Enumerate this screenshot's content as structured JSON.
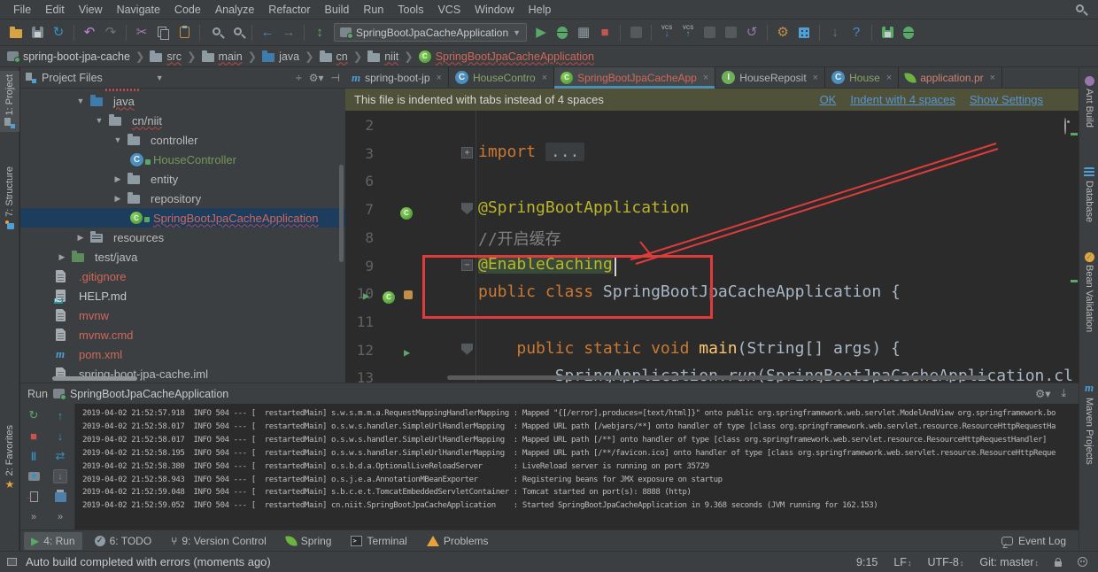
{
  "menu": {
    "items": [
      "File",
      "Edit",
      "View",
      "Navigate",
      "Code",
      "Analyze",
      "Refactor",
      "Build",
      "Run",
      "Tools",
      "VCS",
      "Window",
      "Help"
    ]
  },
  "toolbar": {
    "run_config": "SpringBootJpaCacheApplication",
    "icons": [
      {
        "name": "open-icon",
        "kind": "folder",
        "color": "#d9a343"
      },
      {
        "name": "save-all-icon",
        "kind": "disk",
        "color": "#7d868c"
      },
      {
        "name": "sync-icon",
        "kind": "glyph",
        "glyph": "↻",
        "color": "#3592c4"
      },
      {
        "kind": "sep"
      },
      {
        "name": "undo-icon",
        "kind": "glyph",
        "glyph": "↶",
        "color": "#c286d3"
      },
      {
        "name": "redo-icon",
        "kind": "glyph",
        "glyph": "↷",
        "color": "#707376"
      },
      {
        "kind": "sep"
      },
      {
        "name": "cut-icon",
        "kind": "glyph",
        "glyph": "✂",
        "color": "#a87bb5"
      },
      {
        "name": "copy-icon",
        "kind": "copy"
      },
      {
        "name": "paste-icon",
        "kind": "paste"
      },
      {
        "kind": "sep"
      },
      {
        "name": "find-icon",
        "kind": "search"
      },
      {
        "name": "replace-icon",
        "kind": "search"
      },
      {
        "kind": "sep"
      },
      {
        "name": "back-icon",
        "kind": "glyph",
        "glyph": "←",
        "color": "#4c88c9"
      },
      {
        "name": "forward-icon",
        "kind": "glyph",
        "glyph": "→",
        "color": "#707376"
      },
      {
        "kind": "sep"
      },
      {
        "name": "compare-icon",
        "kind": "glyph",
        "glyph": "↕",
        "color": "#59a869"
      },
      {
        "kind": "runconfig"
      },
      {
        "name": "run-icon",
        "kind": "glyph",
        "glyph": "▶",
        "color": "#59a869"
      },
      {
        "name": "debug-icon",
        "kind": "bug",
        "color": "#59a869"
      },
      {
        "name": "coverage-icon",
        "kind": "glyph",
        "glyph": "▦",
        "color": "#8e9ba3"
      },
      {
        "name": "stop-icon",
        "kind": "glyph",
        "glyph": "■",
        "color": "#c75450"
      },
      {
        "kind": "sep"
      },
      {
        "name": "profiler-icon",
        "kind": "box"
      },
      {
        "kind": "sep"
      },
      {
        "name": "vcs-update-icon",
        "kind": "vcs",
        "arrow": "↓",
        "color": "#4c88c9"
      },
      {
        "name": "vcs-commit-icon",
        "kind": "vcs",
        "arrow": "↑",
        "color": "#59a869"
      },
      {
        "name": "shelve-icon",
        "kind": "box"
      },
      {
        "name": "changes-icon",
        "kind": "box"
      },
      {
        "name": "rollback-icon",
        "kind": "glyph",
        "glyph": "↺",
        "color": "#9876aa"
      },
      {
        "kind": "sep"
      },
      {
        "name": "settings-icon",
        "kind": "glyph",
        "glyph": "⚙",
        "color": "#c08f4a"
      },
      {
        "name": "project-structure-icon",
        "kind": "struct"
      },
      {
        "kind": "sep"
      },
      {
        "name": "download-icon",
        "kind": "glyph",
        "glyph": "↓",
        "color": "#707376"
      },
      {
        "name": "help-icon",
        "kind": "glyph",
        "glyph": "?",
        "color": "#4c88c9"
      },
      {
        "kind": "sep"
      },
      {
        "name": "save-plugin-icon",
        "kind": "disk",
        "color": "#59a869"
      },
      {
        "name": "plugin-bug-icon",
        "kind": "bug",
        "color": "#59a869"
      }
    ]
  },
  "breadcrumb": {
    "items": [
      {
        "label": "spring-boot-jpa-cache",
        "icon": "runcfg",
        "squiggle": false,
        "color": "#c8c8c8"
      },
      {
        "label": "src",
        "icon": "folder",
        "squiggle": true,
        "color": "#bbbbbb"
      },
      {
        "label": "main",
        "icon": "folder",
        "squiggle": true,
        "color": "#bbbbbb"
      },
      {
        "label": "java",
        "icon": "folder-blue",
        "squiggle": false,
        "color": "#bbbbbb"
      },
      {
        "label": "cn",
        "icon": "folder",
        "squiggle": true,
        "color": "#bbbbbb"
      },
      {
        "label": "niit",
        "icon": "folder",
        "squiggle": true,
        "color": "#bbbbbb"
      },
      {
        "label": "SpringBootJpaCacheApplication",
        "icon": "sbrun",
        "squiggle": true,
        "color": "#d1675a"
      }
    ]
  },
  "left_stripe": {
    "top": [
      {
        "label": "1: Project",
        "icon": "proj",
        "selected": true
      },
      {
        "label": "7: Structure",
        "icon": "struct",
        "selected": false
      }
    ],
    "bottom": [
      {
        "label": "2: Favorites",
        "icon": "star",
        "selected": false
      }
    ]
  },
  "right_stripe": {
    "items": [
      {
        "label": "Ant Build",
        "icon": "ant"
      },
      {
        "label": "Database",
        "icon": "db"
      },
      {
        "label": "Bean Validation",
        "icon": "bean"
      },
      {
        "label": "Maven Projects",
        "icon": "m"
      }
    ]
  },
  "project": {
    "title": "Project Files",
    "items": [
      {
        "label": "java",
        "icon": "folder-blue",
        "level": 2,
        "arrow": "open",
        "squiggle": true,
        "color": "#bbbbbb"
      },
      {
        "label": "cn/niit",
        "icon": "folder",
        "level": 3,
        "arrow": "open",
        "squiggle": true,
        "color": "#bbbbbb"
      },
      {
        "label": "controller",
        "icon": "folder",
        "level": 4,
        "arrow": "open",
        "color": "#bbbbbb"
      },
      {
        "label": "HouseController",
        "icon": "class-lock",
        "level": 5,
        "color": "#72975b"
      },
      {
        "label": "entity",
        "icon": "folder",
        "level": 4,
        "arrow": "closed",
        "color": "#bbbbbb"
      },
      {
        "label": "repository",
        "icon": "folder",
        "level": 4,
        "arrow": "closed",
        "color": "#bbbbbb"
      },
      {
        "label": "SpringBootJpaCacheApplication",
        "icon": "sbrun-lock",
        "level": 5,
        "color": "#d1675a",
        "selected": true,
        "squiggle": true
      },
      {
        "label": "resources",
        "icon": "folder-res",
        "level": 2,
        "arrow": "closed",
        "color": "#bbbbbb"
      },
      {
        "label": "test/java",
        "icon": "folder-green",
        "level": 1,
        "arrow": "closed",
        "color": "#bbbbbb"
      },
      {
        "label": ".gitignore",
        "icon": "file",
        "level": 1,
        "color": "#d1675a"
      },
      {
        "label": "HELP.md",
        "icon": "file-md",
        "level": 1,
        "color": "#c8c8c8"
      },
      {
        "label": "mvnw",
        "icon": "file",
        "level": 1,
        "color": "#d1675a"
      },
      {
        "label": "mvnw.cmd",
        "icon": "file",
        "level": 1,
        "color": "#d1675a"
      },
      {
        "label": "pom.xml",
        "icon": "maven",
        "level": 1,
        "color": "#d1675a"
      },
      {
        "label": "spring-boot-jpa-cache.iml",
        "icon": "file",
        "level": 1,
        "color": "#bbbbbb"
      }
    ]
  },
  "tabs": [
    {
      "label": "spring-boot-jp",
      "icon": "maven",
      "color": "#bbbbbb"
    },
    {
      "label": "HouseContro",
      "icon": "class",
      "color": "#8aa36a"
    },
    {
      "label": "SpringBootJpaCacheApp",
      "icon": "sbrun",
      "color": "#d1675a",
      "selected": true
    },
    {
      "label": "HouseReposit",
      "icon": "interface",
      "color": "#afb1b3"
    },
    {
      "label": "House",
      "icon": "class",
      "color": "#8aa36a"
    },
    {
      "label": "application.pr",
      "icon": "leaf",
      "color": "#cf8273"
    }
  ],
  "banner": {
    "text": "This file is indented with tabs instead of 4 spaces",
    "actions": [
      "OK",
      "Indent with 4 spaces",
      "Show Settings"
    ]
  },
  "code": {
    "lines": [
      {
        "num": "2",
        "segs": []
      },
      {
        "num": "3",
        "fold": "plus",
        "segs": [
          {
            "t": "import ",
            "c": "kw"
          },
          {
            "t": "...",
            "c": "foldbox"
          }
        ]
      },
      {
        "num": "6",
        "segs": []
      },
      {
        "num": "7",
        "fold": "pent",
        "gutter": [
          {
            "i": "sbrun",
            "x": 62
          }
        ],
        "segs": [
          {
            "t": "@SpringBootApplication",
            "c": "ann"
          }
        ]
      },
      {
        "num": "8",
        "segs": [
          {
            "t": "//开启缓存",
            "c": "cmt"
          }
        ]
      },
      {
        "num": "9",
        "fold": "minus",
        "segs": [
          {
            "t": "@EnableCaching",
            "c": "ann hlspan"
          }
        ],
        "cursor": true
      },
      {
        "num": "10",
        "gutter": [
          {
            "i": "play",
            "x": 20
          },
          {
            "i": "sbrun",
            "x": 42
          },
          {
            "i": "beans",
            "x": 66
          }
        ],
        "segs": [
          {
            "t": "public class ",
            "c": "kw"
          },
          {
            "t": "SpringBootJpaCacheApplication {",
            "c": "pl"
          }
        ]
      },
      {
        "num": "11",
        "segs": []
      },
      {
        "num": "12",
        "fold": "pent",
        "gutter": [
          {
            "i": "play",
            "x": 66
          }
        ],
        "segs": [
          {
            "t": "    ",
            "c": "pl"
          },
          {
            "t": "public static void ",
            "c": "kw"
          },
          {
            "t": "main",
            "c": "meth"
          },
          {
            "t": "(String[] args) {",
            "c": "pl"
          }
        ]
      },
      {
        "num": "13",
        "segs": [
          {
            "t": "        SpringApplication.",
            "c": "pl"
          },
          {
            "t": "run",
            "c": "pl smeth"
          },
          {
            "t": "(SpringBootJpaCacheApplication.cl",
            "c": "pl"
          }
        ]
      }
    ]
  },
  "run": {
    "label": "Run",
    "config": "SpringBootJpaCacheApplication",
    "log": [
      "2019-04-02 21:52:57.918  INFO 504 --- [  restartedMain] s.w.s.m.m.a.RequestMappingHandlerMapping : Mapped \"{[/error],produces=[text/html]}\" onto public org.springframework.web.servlet.ModelAndView org.springframework.bo",
      "2019-04-02 21:52:58.017  INFO 504 --- [  restartedMain] o.s.w.s.handler.SimpleUrlHandlerMapping  : Mapped URL path [/webjars/**] onto handler of type [class org.springframework.web.servlet.resource.ResourceHttpRequestHa",
      "2019-04-02 21:52:58.017  INFO 504 --- [  restartedMain] o.s.w.s.handler.SimpleUrlHandlerMapping  : Mapped URL path [/**] onto handler of type [class org.springframework.web.servlet.resource.ResourceHttpRequestHandler]",
      "2019-04-02 21:52:58.195  INFO 504 --- [  restartedMain] o.s.w.s.handler.SimpleUrlHandlerMapping  : Mapped URL path [/**/favicon.ico] onto handler of type [class org.springframework.web.servlet.resource.ResourceHttpReque",
      "2019-04-02 21:52:58.380  INFO 504 --- [  restartedMain] o.s.b.d.a.OptionalLiveReloadServer       : LiveReload server is running on port 35729",
      "2019-04-02 21:52:58.943  INFO 504 --- [  restartedMain] o.s.j.e.a.AnnotationMBeanExporter        : Registering beans for JMX exposure on startup",
      "2019-04-02 21:52:59.048  INFO 504 --- [  restartedMain] s.b.c.e.t.TomcatEmbeddedServletContainer : Tomcat started on port(s): 8888 (http)",
      "2019-04-02 21:52:59.052  INFO 504 --- [  restartedMain] cn.niit.SpringBootJpaCacheApplication    : Started SpringBootJpaCacheApplication in 9.368 seconds (JVM running for 162.153)"
    ]
  },
  "bottom": {
    "tabs": [
      {
        "label": "4: Run",
        "icon": "play",
        "selected": true
      },
      {
        "label": "6: TODO",
        "icon": "todo"
      },
      {
        "label": "9: Version Control",
        "icon": "branch"
      },
      {
        "label": "Spring",
        "icon": "leaf"
      },
      {
        "label": "Terminal",
        "icon": "term"
      },
      {
        "label": "Problems",
        "icon": "warn"
      }
    ],
    "event_log": "Event Log"
  },
  "status": {
    "message": "Auto build completed with errors (moments ago)",
    "position": "9:15",
    "line_sep": "LF",
    "encoding": "UTF-8",
    "git": "Git: master"
  }
}
